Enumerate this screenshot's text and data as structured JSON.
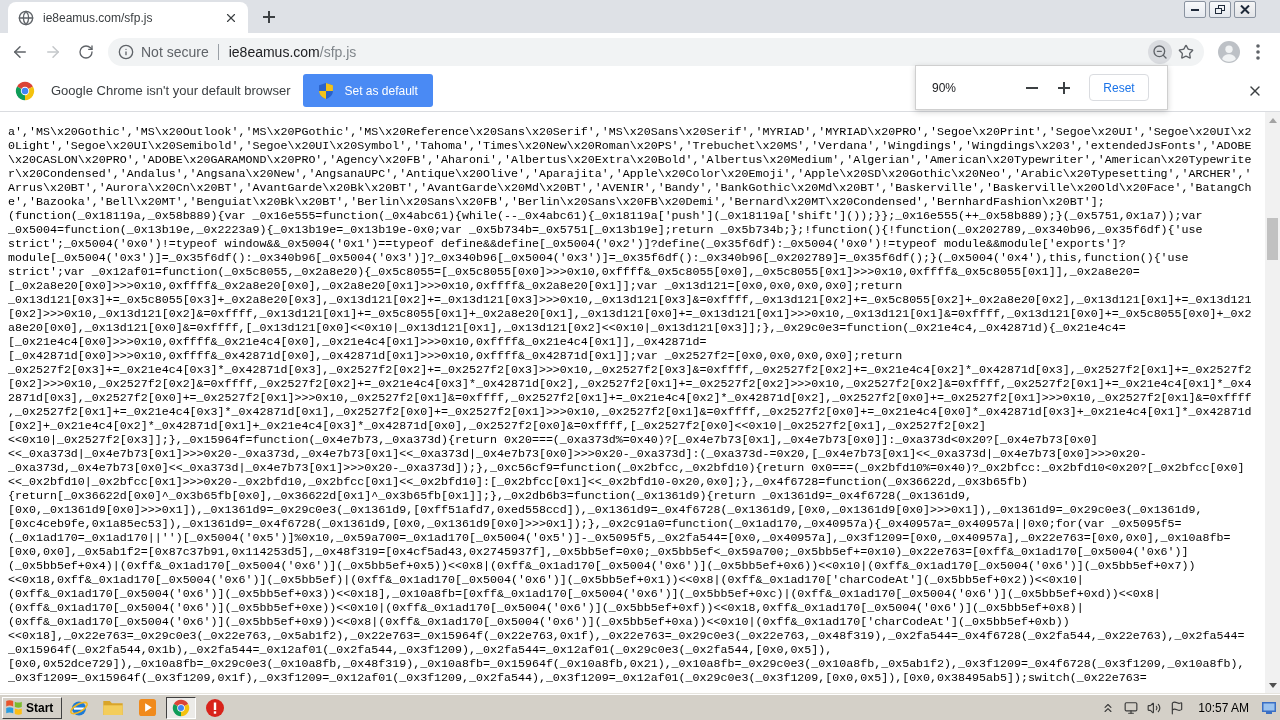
{
  "tabs": [
    {
      "title": "ie8eamus.com/sfp.js",
      "selected": true
    }
  ],
  "toolbar": {
    "back_button": {
      "disabled": false
    },
    "forward_button": {
      "disabled": true
    },
    "security": "Not secure",
    "url_host": "ie8eamus.com",
    "url_path": "/sfp.js"
  },
  "infobar": {
    "message": "Google Chrome isn't your default browser",
    "button": "Set as default"
  },
  "zoom_popup": {
    "zoom": "90%",
    "reset": "Reset"
  },
  "document": {
    "lines": [
      "a','MS\\x20Gothic','MS\\x20Outlook','MS\\x20PGothic','MS\\x20Reference\\x20Sans\\x20Serif','MS\\x20Sans\\x20Serif','MYRIAD','MYRIAD\\x20PRO','Segoe\\x20Print','Segoe\\x20UI','Segoe\\x20UI\\x2",
      "0Light','Segoe\\x20UI\\x20Semibold','Segoe\\x20UI\\x20Symbol','Tahoma','Times\\x20New\\x20Roman\\x20PS','Trebuchet\\x20MS','Verdana','Wingdings','Wingdings\\x203','extendedJsFonts','ADOBE",
      "\\x20CASLON\\x20PRO','ADOBE\\x20GARAMOND\\x20PRO','Agency\\x20FB','Aharoni','Albertus\\x20Extra\\x20Bold','Albertus\\x20Medium','Algerian','American\\x20Typewriter','American\\x20Typewrite",
      "r\\x20Condensed','Andalus','Angsana\\x20New','AngsanaUPC','Antique\\x20Olive','Aparajita','Apple\\x20Color\\x20Emoji','Apple\\x20SD\\x20Gothic\\x20Neo','Arabic\\x20Typesetting','ARCHER','",
      "Arrus\\x20BT','Aurora\\x20Cn\\x20BT','AvantGarde\\x20Bk\\x20BT','AvantGarde\\x20Md\\x20BT','AVENIR','Bandy','BankGothic\\x20Md\\x20BT','Baskerville','Baskerville\\x20Old\\x20Face','BatangCh",
      "e','Bazooka','Bell\\x20MT','Benguiat\\x20Bk\\x20BT','Berlin\\x20Sans\\x20FB','Berlin\\x20Sans\\x20FB\\x20Demi','Bernard\\x20MT\\x20Condensed','BernhardFashion\\x20BT'];",
      "(function(_0x18119a,_0x58b889){var _0x16e555=function(_0x4abc61){while(--_0x4abc61){_0x18119a['push'](_0x18119a['shift']());}};_0x16e555(++_0x58b889);}(_0x5751,0x1a7));var",
      "_0x5004=function(_0x13b19e,_0x2223a9){_0x13b19e=_0x13b19e-0x0;var _0x5b734b=_0x5751[_0x13b19e];return _0x5b734b;};!function(){!function(_0x202789,_0x340b96,_0x35f6df){'use",
      "strict';_0x5004('0x0')!=typeof window&&_0x5004('0x1')==typeof define&&define[_0x5004('0x2')]?define(_0x35f6df):_0x5004('0x0')!=typeof module&&module['exports']?",
      "module[_0x5004('0x3')]=_0x35f6df():_0x340b96[_0x5004('0x3')]?_0x340b96[_0x5004('0x3')]=_0x35f6df():_0x340b96[_0x202789]=_0x35f6df();}(_0x5004('0x4'),this,function(){'use",
      "strict';var _0x12af01=function(_0x5c8055,_0x2a8e20){_0x5c8055=[_0x5c8055[0x0]>>>0x10,0xffff&_0x5c8055[0x0],_0x5c8055[0x1]>>>0x10,0xffff&_0x5c8055[0x1]],_0x2a8e20=",
      "[_0x2a8e20[0x0]>>>0x10,0xffff&_0x2a8e20[0x0],_0x2a8e20[0x1]>>>0x10,0xffff&_0x2a8e20[0x1]];var _0x13d121=[0x0,0x0,0x0,0x0];return",
      "_0x13d121[0x3]+=_0x5c8055[0x3]+_0x2a8e20[0x3],_0x13d121[0x2]+=_0x13d121[0x3]>>>0x10,_0x13d121[0x3]&=0xffff,_0x13d121[0x2]+=_0x5c8055[0x2]+_0x2a8e20[0x2],_0x13d121[0x1]+=_0x13d121",
      "[0x2]>>>0x10,_0x13d121[0x2]&=0xffff,_0x13d121[0x1]+=_0x5c8055[0x1]+_0x2a8e20[0x1],_0x13d121[0x0]+=_0x13d121[0x1]>>>0x10,_0x13d121[0x1]&=0xffff,_0x13d121[0x0]+=_0x5c8055[0x0]+_0x2",
      "a8e20[0x0],_0x13d121[0x0]&=0xffff,[_0x13d121[0x0]<<0x10|_0x13d121[0x1],_0x13d121[0x2]<<0x10|_0x13d121[0x3]];},_0x29c0e3=function(_0x21e4c4,_0x42871d){_0x21e4c4=",
      "[_0x21e4c4[0x0]>>>0x10,0xffff&_0x21e4c4[0x0],_0x21e4c4[0x1]>>>0x10,0xffff&_0x21e4c4[0x1]],_0x42871d=",
      "[_0x42871d[0x0]>>>0x10,0xffff&_0x42871d[0x0],_0x42871d[0x1]>>>0x10,0xffff&_0x42871d[0x1]];var _0x2527f2=[0x0,0x0,0x0,0x0];return",
      "_0x2527f2[0x3]+=_0x21e4c4[0x3]*_0x42871d[0x3],_0x2527f2[0x2]+=_0x2527f2[0x3]>>>0x10,_0x2527f2[0x3]&=0xffff,_0x2527f2[0x2]+=_0x21e4c4[0x2]*_0x42871d[0x3],_0x2527f2[0x1]+=_0x2527f2",
      "[0x2]>>>0x10,_0x2527f2[0x2]&=0xffff,_0x2527f2[0x2]+=_0x21e4c4[0x3]*_0x42871d[0x2],_0x2527f2[0x1]+=_0x2527f2[0x2]>>>0x10,_0x2527f2[0x2]&=0xffff,_0x2527f2[0x1]+=_0x21e4c4[0x1]*_0x4",
      "2871d[0x3],_0x2527f2[0x0]+=_0x2527f2[0x1]>>>0x10,_0x2527f2[0x1]&=0xffff,_0x2527f2[0x1]+=_0x21e4c4[0x2]*_0x42871d[0x2],_0x2527f2[0x0]+=_0x2527f2[0x1]>>>0x10,_0x2527f2[0x1]&=0xffff",
      ",_0x2527f2[0x1]+=_0x21e4c4[0x3]*_0x42871d[0x1],_0x2527f2[0x0]+=_0x2527f2[0x1]>>>0x10,_0x2527f2[0x1]&=0xffff,_0x2527f2[0x0]+=_0x21e4c4[0x0]*_0x42871d[0x3]+_0x21e4c4[0x1]*_0x42871d",
      "[0x2]+_0x21e4c4[0x2]*_0x42871d[0x1]+_0x21e4c4[0x3]*_0x42871d[0x0],_0x2527f2[0x0]&=0xffff,[_0x2527f2[0x0]<<0x10|_0x2527f2[0x1],_0x2527f2[0x2]",
      "<<0x10|_0x2527f2[0x3]];},_0x15964f=function(_0x4e7b73,_0xa373d){return 0x20===(_0xa373d%=0x40)?[_0x4e7b73[0x1],_0x4e7b73[0x0]]:_0xa373d<0x20?[_0x4e7b73[0x0]",
      "<<_0xa373d|_0x4e7b73[0x1]>>>0x20-_0xa373d,_0x4e7b73[0x1]<<_0xa373d|_0x4e7b73[0x0]>>>0x20-_0xa373d]:(_0xa373d-=0x20,[_0x4e7b73[0x1]<<_0xa373d|_0x4e7b73[0x0]>>>0x20-",
      "_0xa373d,_0x4e7b73[0x0]<<_0xa373d|_0x4e7b73[0x1]>>>0x20-_0xa373d]);},_0xc56cf9=function(_0x2bfcc,_0x2bfd10){return 0x0===(_0x2bfd10%=0x40)?_0x2bfcc:_0x2bfd10<0x20?[_0x2bfcc[0x0]",
      "<<_0x2bfd10|_0x2bfcc[0x1]>>>0x20-_0x2bfd10,_0x2bfcc[0x1]<<_0x2bfd10]:[_0x2bfcc[0x1]<<_0x2bfd10-0x20,0x0];},_0x4f6728=function(_0x36622d,_0x3b65fb)",
      "{return[_0x36622d[0x0]^_0x3b65fb[0x0],_0x36622d[0x1]^_0x3b65fb[0x1]];},_0x2db6b3=function(_0x1361d9){return _0x1361d9=_0x4f6728(_0x1361d9,",
      "[0x0,_0x1361d9[0x0]>>>0x1]),_0x1361d9=_0x29c0e3(_0x1361d9,[0xff51afd7,0xed558ccd]),_0x1361d9=_0x4f6728(_0x1361d9,[0x0,_0x1361d9[0x0]>>>0x1]),_0x1361d9=_0x29c0e3(_0x1361d9,",
      "[0xc4ceb9fe,0x1a85ec53]),_0x1361d9=_0x4f6728(_0x1361d9,[0x0,_0x1361d9[0x0]>>>0x1]);},_0x2c91a0=function(_0x1ad170,_0x40957a){_0x40957a=_0x40957a||0x0;for(var _0x5095f5=",
      "(_0x1ad170=_0x1ad170||'')[_0x5004('0x5')]%0x10,_0x59a700=_0x1ad170[_0x5004('0x5')]-_0x5095f5,_0x2fa544=[0x0,_0x40957a],_0x3f1209=[0x0,_0x40957a],_0x22e763=[0x0,0x0],_0x10a8fb=",
      "[0x0,0x0],_0x5ab1f2=[0x87c37b91,0x114253d5],_0x48f319=[0x4cf5ad43,0x2745937f],_0x5bb5ef=0x0;_0x5bb5ef<_0x59a700;_0x5bb5ef+=0x10)_0x22e763=[0xff&_0x1ad170[_0x5004('0x6')]",
      "(_0x5bb5ef+0x4)|(0xff&_0x1ad170[_0x5004('0x6')](_0x5bb5ef+0x5))<<0x8|(0xff&_0x1ad170[_0x5004('0x6')](_0x5bb5ef+0x6))<<0x10|(0xff&_0x1ad170[_0x5004('0x6')](_0x5bb5ef+0x7))",
      "<<0x18,0xff&_0x1ad170[_0x5004('0x6')](_0x5bb5ef)|(0xff&_0x1ad170[_0x5004('0x6')](_0x5bb5ef+0x1))<<0x8|(0xff&_0x1ad170['charCodeAt'](_0x5bb5ef+0x2))<<0x10|",
      "(0xff&_0x1ad170[_0x5004('0x6')](_0x5bb5ef+0x3))<<0x18],_0x10a8fb=[0xff&_0x1ad170[_0x5004('0x6')](_0x5bb5ef+0xc)|(0xff&_0x1ad170[_0x5004('0x6')](_0x5bb5ef+0xd))<<0x8|",
      "(0xff&_0x1ad170[_0x5004('0x6')](_0x5bb5ef+0xe))<<0x10|(0xff&_0x1ad170[_0x5004('0x6')](_0x5bb5ef+0xf))<<0x18,0xff&_0x1ad170[_0x5004('0x6')](_0x5bb5ef+0x8)|",
      "(0xff&_0x1ad170[_0x5004('0x6')](_0x5bb5ef+0x9))<<0x8|(0xff&_0x1ad170[_0x5004('0x6')](_0x5bb5ef+0xa))<<0x10|(0xff&_0x1ad170['charCodeAt'](_0x5bb5ef+0xb))",
      "<<0x18],_0x22e763=_0x29c0e3(_0x22e763,_0x5ab1f2),_0x22e763=_0x15964f(_0x22e763,0x1f),_0x22e763=_0x29c0e3(_0x22e763,_0x48f319),_0x2fa544=_0x4f6728(_0x2fa544,_0x22e763),_0x2fa544=",
      "_0x15964f(_0x2fa544,0x1b),_0x2fa544=_0x12af01(_0x2fa544,_0x3f1209),_0x2fa544=_0x12af01(_0x29c0e3(_0x2fa544,[0x0,0x5]),",
      "[0x0,0x52dce729]),_0x10a8fb=_0x29c0e3(_0x10a8fb,_0x48f319),_0x10a8fb=_0x15964f(_0x10a8fb,0x21),_0x10a8fb=_0x29c0e3(_0x10a8fb,_0x5ab1f2),_0x3f1209=_0x4f6728(_0x3f1209,_0x10a8fb),",
      "_0x3f1209=_0x15964f(_0x3f1209,0x1f),_0x3f1209=_0x12af01(_0x3f1209,_0x2fa544),_0x3f1209=_0x12af01(_0x29c0e3(_0x3f1209,[0x0,0x5]),[0x0,0x38495ab5]);switch(_0x22e763="
    ]
  },
  "taskbar": {
    "start": "Start",
    "apps": [
      {
        "selected": false
      },
      {
        "selected": false
      },
      {
        "selected": false
      },
      {
        "selected": true
      },
      {
        "selected": false
      }
    ],
    "clock": "10:57 AM"
  }
}
